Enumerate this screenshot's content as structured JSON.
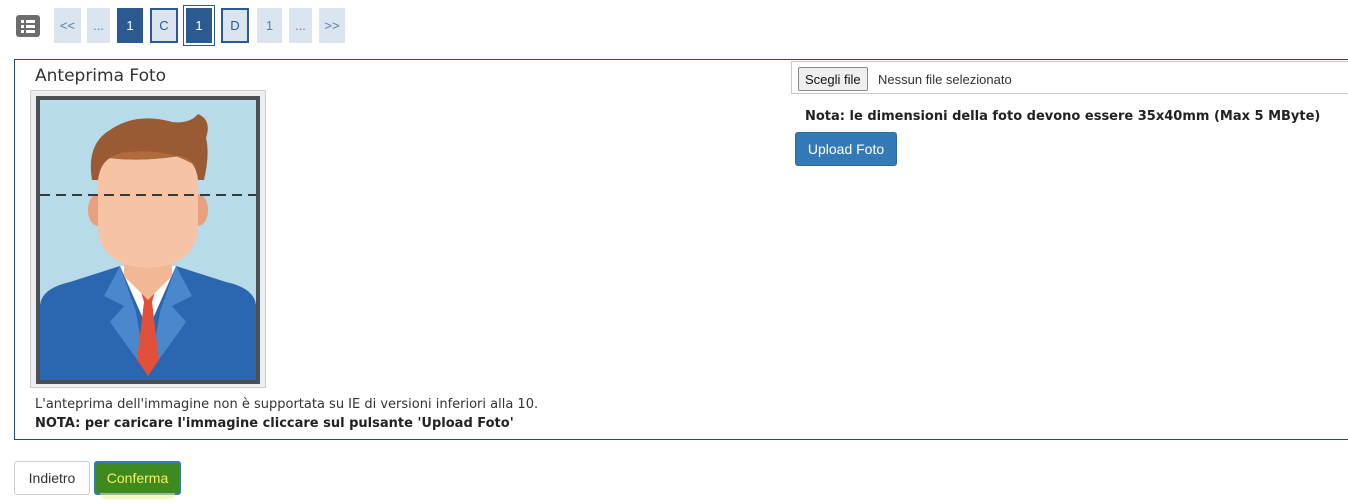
{
  "nav": {
    "menu_icon": "list-icon",
    "steps": [
      {
        "label": "<<",
        "style": "light",
        "role": "first"
      },
      {
        "label": "...",
        "style": "light",
        "role": "ellipsis"
      },
      {
        "label": "1",
        "style": "dark",
        "role": "step"
      },
      {
        "label": "C",
        "style": "outlined",
        "role": "step"
      },
      {
        "label": "1",
        "style": "outlined-dark",
        "role": "current-step"
      },
      {
        "label": "D",
        "style": "outlined",
        "role": "step"
      },
      {
        "label": "1",
        "style": "light",
        "role": "step"
      },
      {
        "label": "...",
        "style": "light",
        "role": "ellipsis"
      },
      {
        "label": ">>",
        "style": "light",
        "role": "last"
      }
    ]
  },
  "preview": {
    "title": "Anteprima Foto",
    "image": "passport-photo-placeholder",
    "ie_note": "L'anteprima dell'immagine non è supportata su IE di versioni inferiori alla 10.",
    "upload_note": "NOTA: per caricare l'immagine cliccare sul pulsante 'Upload Foto'"
  },
  "upload": {
    "choose_file_label": "Scegli file",
    "file_status": "Nessun file selezionato",
    "size_note": "Nota: le dimensioni della foto devono essere 35x40mm (Max 5 MByte)",
    "upload_label": "Upload Foto"
  },
  "actions": {
    "back_label": "Indietro",
    "confirm_label": "Conferma"
  },
  "colors": {
    "primary": "#337ab7",
    "step_dark": "#2b5a91",
    "step_light": "#dbe5f0",
    "confirm_bg": "#3f8a1e",
    "confirm_text": "#f5f06a",
    "panel_border": "#1f4e79"
  }
}
